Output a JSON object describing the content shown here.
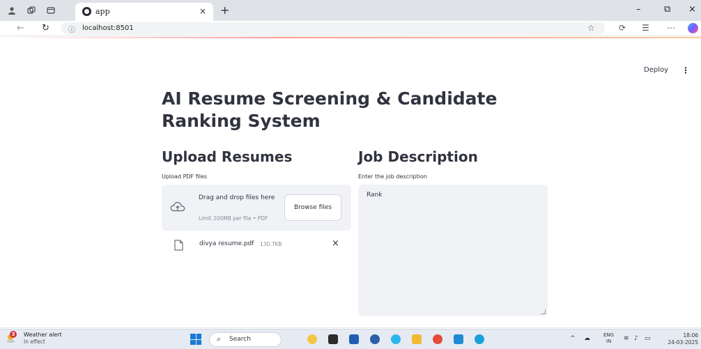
{
  "browser": {
    "tab_title": "app",
    "tab_close": "×",
    "new_tab": "+",
    "url": "localhost:8501",
    "minimize": "–",
    "restore": "⧉",
    "close": "×"
  },
  "header": {
    "deploy_label": "Deploy",
    "menu_label": "⋮"
  },
  "main": {
    "title": "AI Resume Screening & Candidate Ranking System",
    "upload": {
      "heading": "Upload Resumes",
      "label": "Upload PDF files",
      "dropzone_text": "Drag and drop files here",
      "limit_text": "Limit 200MB per file • PDF",
      "browse_label": "Browse files",
      "files": [
        {
          "name": "divya resume.pdf",
          "size": "130.7KB",
          "remove": "×"
        }
      ]
    },
    "job": {
      "heading": "Job Description",
      "label": "Enter the job description",
      "value": "Rank"
    }
  },
  "taskbar": {
    "weather_badge": "3",
    "weather_title": "Weather alert",
    "weather_sub": "In effect",
    "search_label": "Search",
    "lang_top": "ENG",
    "lang_bottom": "IN",
    "time": "18:06",
    "date": "24-03-2025"
  },
  "colors": {
    "text": "#31333f",
    "widget_bg": "#f0f2f6",
    "accent": "#ff4b4b"
  }
}
